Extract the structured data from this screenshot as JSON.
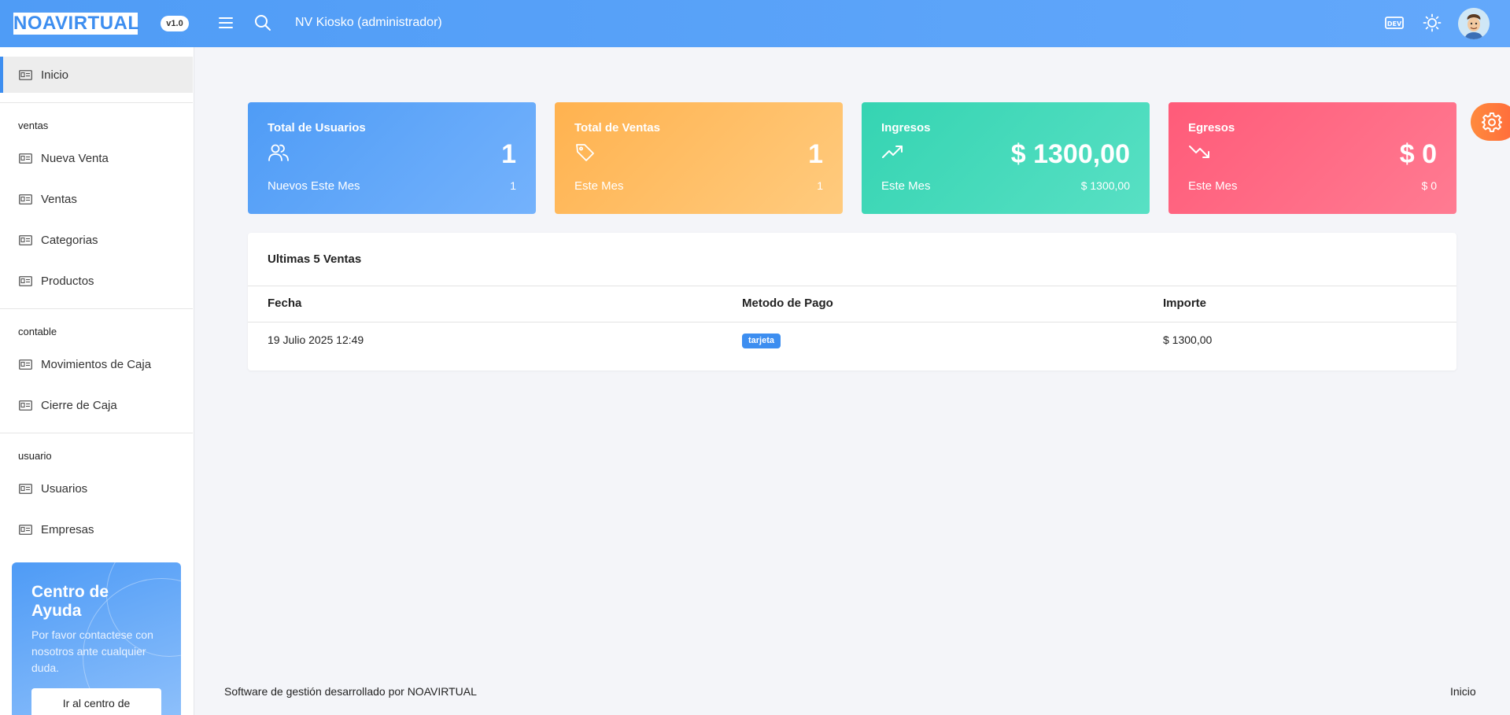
{
  "header": {
    "logo": "NOAVIRTUAL",
    "version": "v1.0",
    "title": "NV Kiosko (administrador)",
    "dev_badge": "DEV",
    "icons": [
      "menu-icon",
      "search-icon",
      "dev-icon",
      "sun-icon",
      "avatar"
    ]
  },
  "sidebar": {
    "home": "Inicio",
    "sections": [
      {
        "title": "ventas",
        "items": [
          "Nueva Venta",
          "Ventas",
          "Categorias",
          "Productos"
        ]
      },
      {
        "title": "contable",
        "items": [
          "Movimientos de Caja",
          "Cierre de Caja"
        ]
      },
      {
        "title": "usuario",
        "items": [
          "Usuarios",
          "Empresas"
        ]
      }
    ],
    "help": {
      "title": "Centro de Ayuda",
      "text": "Por favor contactese con nosotros ante cualquier duda.",
      "button": "Ir al centro de"
    }
  },
  "stats": [
    {
      "title": "Total de Usuarios",
      "icon": "users-icon",
      "value": "1",
      "sub_label": "Nuevos Este Mes",
      "sub_value": "1",
      "color_from": "#4f9cf6",
      "color_to": "#74b2fc"
    },
    {
      "title": "Total de Ventas",
      "icon": "tag-icon",
      "value": "1",
      "sub_label": "Este Mes",
      "sub_value": "1",
      "color_from": "#ffb24f",
      "color_to": "#ffcb7e"
    },
    {
      "title": "Ingresos",
      "icon": "trending-up-icon",
      "value": "$ 1300,00",
      "sub_label": "Este Mes",
      "sub_value": "$ 1300,00",
      "color_from": "#35d4b2",
      "color_to": "#58e0c4"
    },
    {
      "title": "Egresos",
      "icon": "trending-down-icon",
      "value": "$ 0",
      "sub_label": "Este Mes",
      "sub_value": "$ 0",
      "color_from": "#ff5b79",
      "color_to": "#ff7b92"
    }
  ],
  "sales": {
    "title": "Ultimas 5 Ventas",
    "columns": [
      "Fecha",
      "Metodo de Pago",
      "Importe"
    ],
    "rows": [
      {
        "fecha": "19 Julio 2025 12:49",
        "metodo": "tarjeta",
        "importe": "$ 1300,00"
      }
    ]
  },
  "footer": {
    "left": "Software de gestión desarrollado por NOAVIRTUAL",
    "right": "Inicio"
  },
  "colors": {
    "primary": "#3d8ef0",
    "orange": "#ff7a3c"
  }
}
